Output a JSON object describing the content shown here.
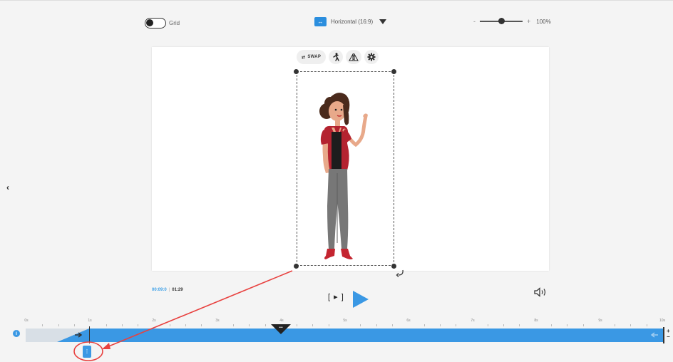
{
  "grid_toggle": {
    "label": "Grid"
  },
  "orientation": {
    "icon": "horizontal-arrows-icon",
    "label": "Horizontal (16:9)"
  },
  "zoom": {
    "minus": "-",
    "plus": "+",
    "value": "100%",
    "level": 0.5
  },
  "toolbar": {
    "swap_label": "SWAP",
    "icons": [
      "swap-icon",
      "action-figure-icon",
      "flip-icon",
      "settings-gear-icon"
    ]
  },
  "playback": {
    "current_time": "00:09:0",
    "total_time": "01:29",
    "preview_label": "[ ▸ ]"
  },
  "timeline": {
    "ruler": [
      "0s",
      "1s",
      "2s",
      "3s",
      "4s",
      "5s",
      "6s",
      "7s",
      "8s",
      "9s",
      "10s"
    ],
    "info": "i",
    "zoom_plus": "+",
    "zoom_minus": "−",
    "marker_label": "•••"
  },
  "colors": {
    "accent": "#3a98e4",
    "annotation": "#e8413f"
  }
}
